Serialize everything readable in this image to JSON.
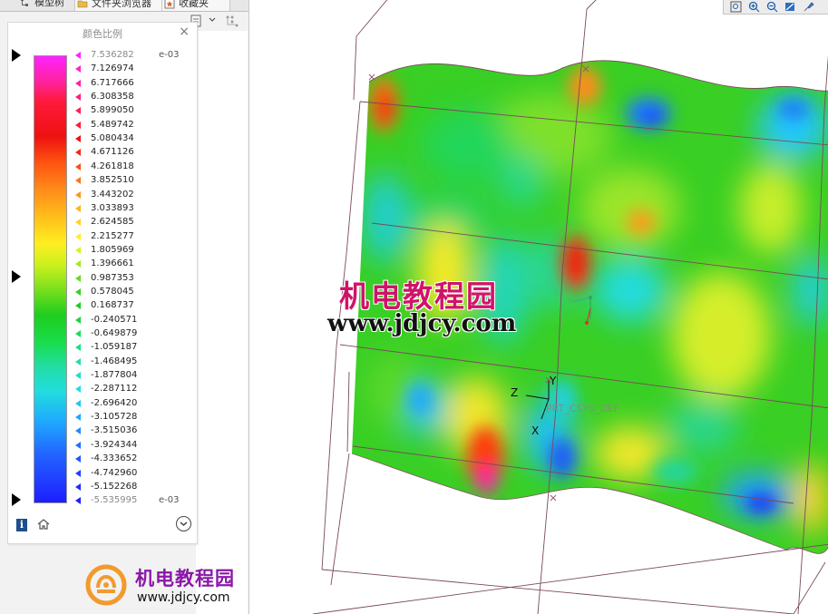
{
  "navigator": {
    "tabs": [
      {
        "label": "模型树"
      },
      {
        "label": "文件夹浏览器"
      },
      {
        "label": "收藏夹"
      }
    ]
  },
  "color_scale": {
    "title": "颜色比例",
    "close_glyph": "×",
    "unit": "e-03",
    "values": [
      "7.536282",
      "7.126974",
      "6.717666",
      "6.308358",
      "5.899050",
      "5.489742",
      "5.080434",
      "4.671126",
      "4.261818",
      "3.852510",
      "3.443202",
      "3.033893",
      "2.624585",
      "2.215277",
      "1.805969",
      "1.396661",
      "0.987353",
      "0.578045",
      "0.168737",
      "-0.240571",
      "-0.649879",
      "-1.059187",
      "-1.468495",
      "-1.877804",
      "-2.287112",
      "-2.696420",
      "-3.105728",
      "-3.515036",
      "-3.924344",
      "-4.333652",
      "-4.742960",
      "-5.152268",
      "-5.535995"
    ],
    "marker_colors": [
      "#ff22ff",
      "#ff22cc",
      "#ff22aa",
      "#ff1f7d",
      "#ff1f55",
      "#ff1a33",
      "#ee1111",
      "#f12a12",
      "#ff4f11",
      "#ff7418",
      "#ff951a",
      "#ffb41a",
      "#ffd41e",
      "#ffee22",
      "#d8f21e",
      "#a6e81e",
      "#6ada1e",
      "#33d21e",
      "#1fcd1f",
      "#19d43a",
      "#19dd5c",
      "#1edd86",
      "#22ddaa",
      "#22ddc6",
      "#22dddd",
      "#22c6ee",
      "#1fa8ff",
      "#1f8cff",
      "#2270ff",
      "#2255ff",
      "#2040ff",
      "#1e2cff",
      "#1e1eff"
    ],
    "footer": {
      "info_icon": "info-icon",
      "home_icon": "home-icon",
      "expand_icon": "chevron-down-circle-icon"
    }
  },
  "logo": {
    "name_cn": "机电教程园",
    "url": "www.jdjcy.com"
  },
  "viewport": {
    "watermark_cn": "机电教程园",
    "watermark_url": "www.jdjcy.com",
    "axis_labels": {
      "z": "Z",
      "y": "Y",
      "x": "X"
    },
    "csys_label": "PRT_CSYS_DEF",
    "toolbar_icons": [
      "zoom-fit-icon",
      "zoom-in-icon",
      "zoom-out-icon",
      "repaint-icon",
      "pan-icon"
    ]
  }
}
